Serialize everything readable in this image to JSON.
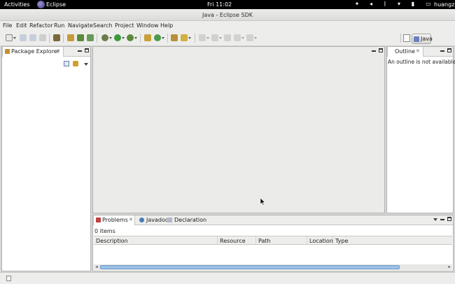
{
  "topbar": {
    "activities": "Activities",
    "app_name": "Eclipse",
    "clock": "Fri 11:02",
    "user": "huangz"
  },
  "window": {
    "title": "Java - Eclipse SDK"
  },
  "menu": {
    "items": [
      "File",
      "Edit",
      "Refactor",
      "Run",
      "Navigate",
      "Search",
      "Project",
      "Window",
      "Help"
    ]
  },
  "perspective": {
    "java_label": "Java"
  },
  "package_explorer": {
    "title": "Package Explorer"
  },
  "outline": {
    "title": "Outline",
    "message": "An outline is not available."
  },
  "bottom_panel": {
    "tabs": [
      "Problems",
      "Javadoc",
      "Declaration"
    ],
    "items_count": "0 items",
    "columns": [
      "Description",
      "Resource",
      "Path",
      "Location",
      "Type"
    ]
  },
  "colors": {
    "accent": "#3c8cd8",
    "scrollbar": "#9cc0e6"
  }
}
